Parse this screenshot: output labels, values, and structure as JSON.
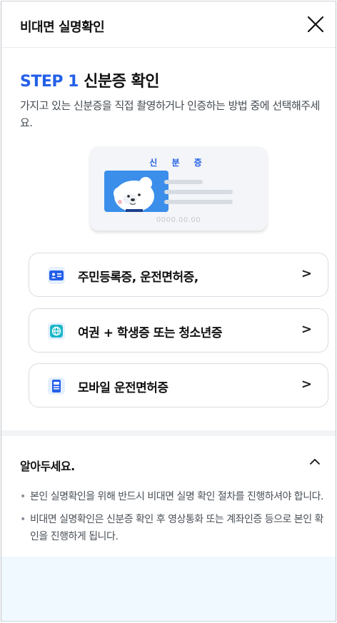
{
  "header": {
    "title": "비대면 실명확인",
    "close_icon": "close-icon"
  },
  "step": {
    "number": "STEP 1",
    "title": "신분증 확인",
    "description": "가지고 있는 신분증을 직접 촬영하거나 인증하는 방법 중에 선택해주세요."
  },
  "id_card": {
    "title": "신 분 증",
    "date": "0000.00.00"
  },
  "options": [
    {
      "label": "주민등록증, 운전면허증,",
      "icon": "id-card-icon",
      "chevron": ">"
    },
    {
      "label": "여권 + 학생증 또는 청소년증",
      "icon": "globe-icon",
      "chevron": ">"
    },
    {
      "label": "모바일 운전면허증",
      "icon": "mobile-license-icon",
      "chevron": ">"
    }
  ],
  "notice": {
    "title": "알아두세요.",
    "toggle_icon": "chevron-up-icon",
    "items": [
      "본인 실명확인을 위해 반드시 비대면 실명 확인 절차를 진행하셔야 합니다.",
      "비대면 실명확인은 신분증 확인 후 영상통화 또는 계좌인증 등으로 본인 확인을 진행하게 됩니다."
    ]
  },
  "colors": {
    "accent": "#2360e8",
    "icon_bg": "#e5f0ff",
    "divider": "#f2f4f6",
    "bottom_band": "#f0f9ff"
  }
}
